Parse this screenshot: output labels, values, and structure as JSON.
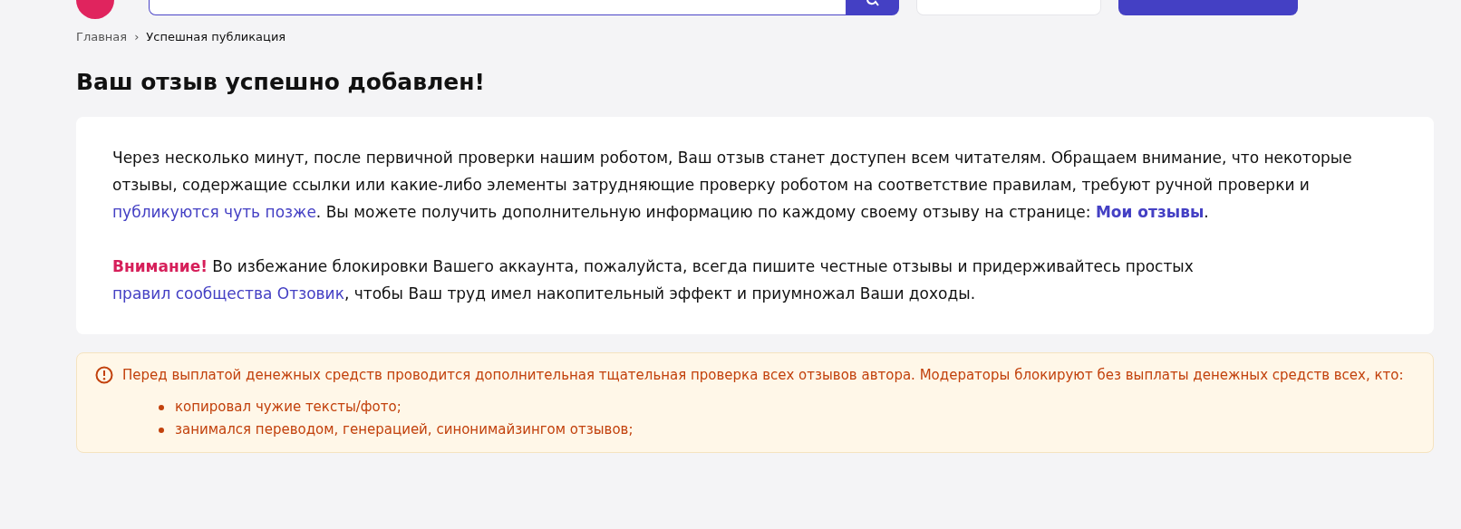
{
  "breadcrumbs": [
    {
      "label": "Главная",
      "kind": "link"
    },
    {
      "label": "Успешная публикация",
      "kind": "current"
    }
  ],
  "breadcrumb_separator": "›",
  "title": "Ваш отзыв успешно добавлен!",
  "notice": {
    "paragraphs": [
      [
        {
          "kind": "text",
          "text": "Через несколько минут, после первичной проверки нашим роботом, Ваш отзыв станет доступен всем читателям. Обращаем внимание, что некоторые отзывы, содержащие ссылки или какие-либо элементы затрудняющие проверку роботом на соответствие правилам, требуют ручной проверки и "
        },
        {
          "kind": "link",
          "text": "публикуются чуть позже"
        },
        {
          "kind": "text",
          "text": ". Вы можете получить дополнительную информацию по каждому своему отзыву на странице: "
        },
        {
          "kind": "bold-link",
          "text": "Мои отзывы"
        },
        {
          "kind": "text",
          "text": "."
        }
      ],
      [
        {
          "kind": "alert",
          "text": "Внимание!"
        },
        {
          "kind": "text",
          "text": " Во избежание блокировки Вашего аккаунта, пожалуйста, всегда пишите честные отзывы и придерживайтесь простых "
        },
        {
          "kind": "link",
          "text": "правил сообщества Отзовик"
        },
        {
          "kind": "text",
          "text": ", чтобы Ваш труд имел накопительный эффект и приумножал Ваши доходы."
        }
      ]
    ]
  },
  "warning": {
    "text": "Перед выплатой денежных средств проводится дополнительная тщательная проверка всех отзывов автора. Модераторы блокируют без выплаты денежных средств всех, кто:",
    "items": [
      "копировал чужие тексты/фото;",
      "занимался переводом, генерацией, синонимайзингом отзывов;"
    ]
  }
}
